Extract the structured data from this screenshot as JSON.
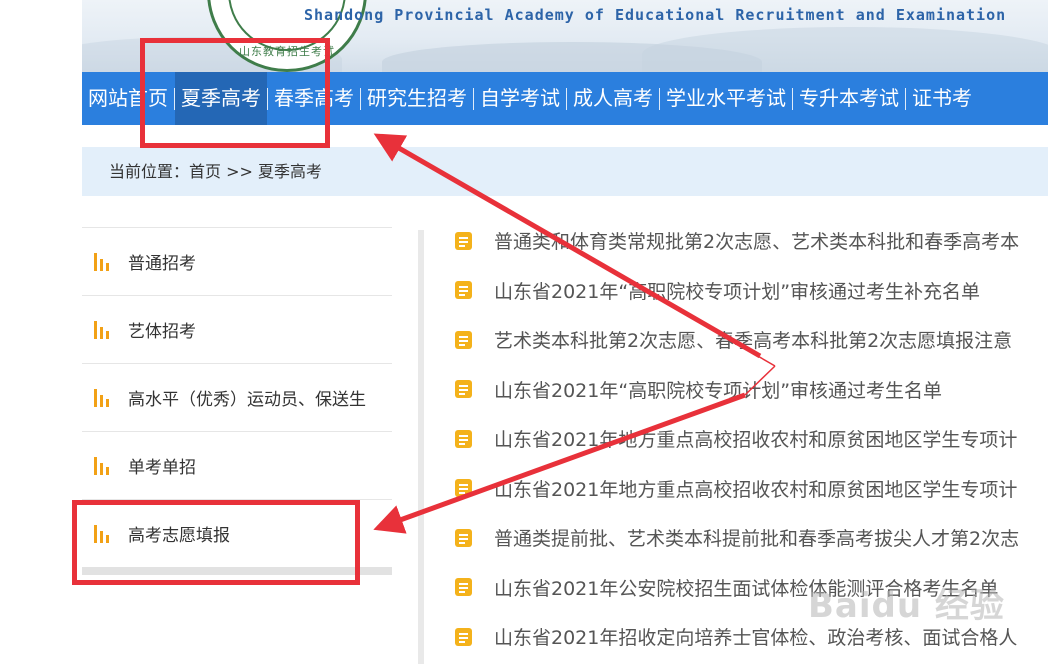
{
  "header": {
    "seal_text": "山东教育招生考试",
    "en_title": "Shandong Provincial Academy of Educational Recruitment and Examination"
  },
  "nav": {
    "items": [
      {
        "label": "网站首页"
      },
      {
        "label": "夏季高考",
        "active": true
      },
      {
        "label": "春季高考"
      },
      {
        "label": "研究生招考"
      },
      {
        "label": "自学考试"
      },
      {
        "label": "成人高考"
      },
      {
        "label": "学业水平考试"
      },
      {
        "label": "专升本考试"
      },
      {
        "label": "证书考"
      }
    ]
  },
  "breadcrumb": {
    "prefix": "当前位置：",
    "home": "首页",
    "sep": " >> ",
    "current": "夏季高考"
  },
  "sidebar": {
    "items": [
      {
        "label": "普通招考"
      },
      {
        "label": "艺体招考"
      },
      {
        "label": "高水平（优秀）运动员、保送生"
      },
      {
        "label": "单考单招"
      },
      {
        "label": "高考志愿填报"
      }
    ]
  },
  "news": {
    "items": [
      {
        "title": "普通类和体育类常规批第2次志愿、艺术类本科批和春季高考本"
      },
      {
        "title": "山东省2021年“高职院校专项计划”审核通过考生补充名单"
      },
      {
        "title": "艺术类本科批第2次志愿、春季高考本科批第2次志愿填报注意"
      },
      {
        "title": "山东省2021年“高职院校专项计划”审核通过考生名单"
      },
      {
        "title": "山东省2021年地方重点高校招收农村和原贫困地区学生专项计"
      },
      {
        "title": "山东省2021年地方重点高校招收农村和原贫困地区学生专项计"
      },
      {
        "title": "普通类提前批、艺术类本科提前批和春季高考拔尖人才第2次志"
      },
      {
        "title": "山东省2021年公安院校招生面试体检体能测评合格考生名单"
      },
      {
        "title": "山东省2021年招收定向培养士官体检、政治考核、面试合格人"
      }
    ]
  },
  "watermark": "Baidu 经验",
  "colors": {
    "nav_bg": "#2b7fde",
    "nav_active": "#2467b5",
    "breadcrumb_bg": "#e3effa",
    "accent_icon": "#f4b21b",
    "annotation_red": "#e8313a"
  }
}
